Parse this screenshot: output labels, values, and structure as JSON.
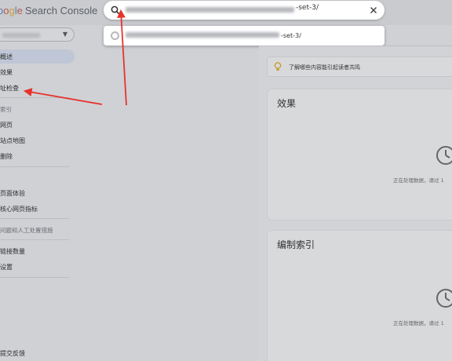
{
  "header": {
    "logo_letters": [
      "o",
      "o",
      "g",
      "l",
      "e"
    ],
    "logo_product": "Search Console"
  },
  "search": {
    "value_suffix": "-set-3/"
  },
  "suggestion": {
    "value_suffix": "-set-3/"
  },
  "sidebar": {
    "items": [
      {
        "label": "概述"
      },
      {
        "label": "效果"
      },
      {
        "label": "址检查"
      },
      {
        "label": "索引"
      },
      {
        "label": "网页"
      },
      {
        "label": "站点地图"
      },
      {
        "label": "删除"
      },
      {
        "label": "页面体验"
      },
      {
        "label": "核心网页指标"
      },
      {
        "label": "问题和人工处置措施"
      },
      {
        "label": "链接数量"
      },
      {
        "label": "设置"
      },
      {
        "label": "提交反馈"
      }
    ]
  },
  "tip": {
    "text": "了解哪些内容能引起读者共鸣"
  },
  "cards": [
    {
      "title": "效果",
      "processing": "正在处理数据，请过 1"
    },
    {
      "title": "编制索引",
      "processing": "正在处理数据，请过 1"
    }
  ],
  "colors": {
    "annotation_arrow": "#e8322c",
    "accent": "#5b7bb4"
  }
}
